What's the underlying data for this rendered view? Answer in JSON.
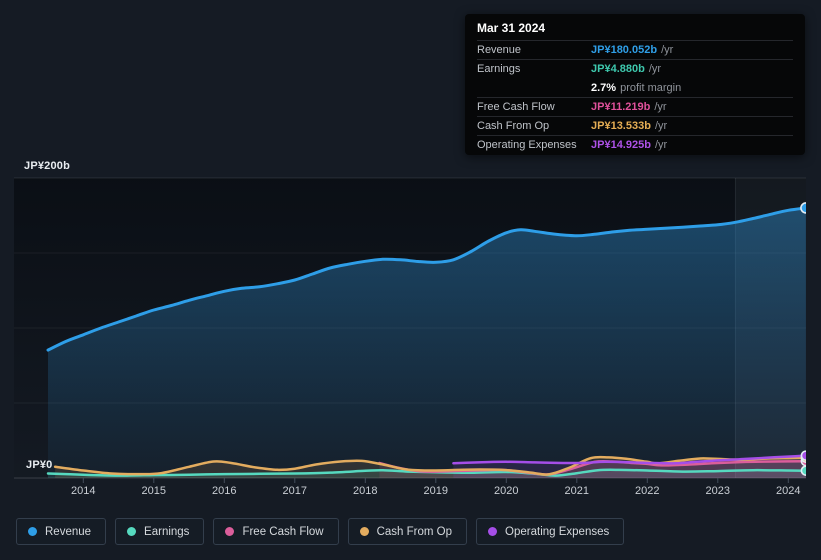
{
  "y_axis": {
    "top_label": "JP¥200b",
    "bottom_label": "JP¥0"
  },
  "x_axis": {
    "labels": [
      "2014",
      "2015",
      "2016",
      "2017",
      "2018",
      "2019",
      "2020",
      "2021",
      "2022",
      "2023",
      "2024"
    ]
  },
  "tooltip": {
    "title": "Mar 31 2024",
    "rows": [
      {
        "label": "Revenue",
        "value": "JP¥180.052b",
        "unit": "/yr",
        "color": "#2f9fe8"
      },
      {
        "label": "Earnings",
        "value": "JP¥4.880b",
        "unit": "/yr",
        "color": "#3ec9ae"
      },
      {
        "label": "Free Cash Flow",
        "value": "JP¥11.219b",
        "unit": "/yr",
        "color": "#e0519b"
      },
      {
        "label": "Cash From Op",
        "value": "JP¥13.533b",
        "unit": "/yr",
        "color": "#e6ae54"
      },
      {
        "label": "Operating Expenses",
        "value": "JP¥14.925b",
        "unit": "/yr",
        "color": "#ae52e8"
      }
    ],
    "profit_margin": {
      "value": "2.7%",
      "text": "profit margin"
    }
  },
  "legend": {
    "items": [
      {
        "label": "Revenue",
        "color": "#2e9ee8"
      },
      {
        "label": "Earnings",
        "color": "#56d9bf"
      },
      {
        "label": "Free Cash Flow",
        "color": "#db5e9b"
      },
      {
        "label": "Cash From Op",
        "color": "#e3ac5f"
      },
      {
        "label": "Operating Expenses",
        "color": "#a54ee8"
      }
    ]
  },
  "chart_data": {
    "type": "area",
    "title": "Company financial history, JP¥ billions vs fiscal year",
    "unit": "JP¥ billions per year",
    "ylim": [
      0,
      200
    ],
    "gridline_values": [
      0,
      50,
      100,
      150,
      200
    ],
    "x_tick_years": [
      2014,
      2015,
      2016,
      2017,
      2018,
      2019,
      2020,
      2021,
      2022,
      2023,
      2024
    ],
    "highlight_band_years": [
      2023.25,
      2024.32
    ],
    "legend_position": "bottom-left",
    "series": [
      {
        "name": "Revenue",
        "color": "#2e9ee8",
        "points": [
          [
            2013.5,
            85.3
          ],
          [
            2013.75,
            91
          ],
          [
            2014,
            95.5
          ],
          [
            2014.25,
            100
          ],
          [
            2014.5,
            104
          ],
          [
            2014.75,
            108
          ],
          [
            2015,
            112
          ],
          [
            2015.25,
            115
          ],
          [
            2015.5,
            118.5
          ],
          [
            2015.75,
            121.5
          ],
          [
            2016,
            124.5
          ],
          [
            2016.25,
            126.5
          ],
          [
            2016.5,
            127.5
          ],
          [
            2016.75,
            129.5
          ],
          [
            2017,
            132
          ],
          [
            2017.25,
            136
          ],
          [
            2017.5,
            140
          ],
          [
            2017.75,
            142.5
          ],
          [
            2018,
            144.5
          ],
          [
            2018.25,
            145.8
          ],
          [
            2018.5,
            145.5
          ],
          [
            2018.75,
            144.3
          ],
          [
            2019,
            143.8
          ],
          [
            2019.25,
            145.5
          ],
          [
            2019.5,
            151
          ],
          [
            2019.75,
            158
          ],
          [
            2020,
            163.5
          ],
          [
            2020.2,
            165.5
          ],
          [
            2020.4,
            164.5
          ],
          [
            2020.7,
            162.5
          ],
          [
            2021,
            161.5
          ],
          [
            2021.25,
            162.5
          ],
          [
            2021.5,
            164
          ],
          [
            2021.75,
            165.2
          ],
          [
            2022,
            165.8
          ],
          [
            2022.25,
            166.5
          ],
          [
            2022.5,
            167.2
          ],
          [
            2022.75,
            168
          ],
          [
            2023,
            168.8
          ],
          [
            2023.25,
            170.5
          ],
          [
            2023.5,
            173
          ],
          [
            2023.75,
            175.8
          ],
          [
            2024,
            178.5
          ],
          [
            2024.25,
            180.052
          ]
        ]
      },
      {
        "name": "Earnings",
        "color": "#56d9bf",
        "points": [
          [
            2013.5,
            3.0
          ],
          [
            2014,
            2.2
          ],
          [
            2014.5,
            1.6
          ],
          [
            2015,
            1.9
          ],
          [
            2015.5,
            2.2
          ],
          [
            2016,
            2.6
          ],
          [
            2016.5,
            2.8
          ],
          [
            2017,
            3.0
          ],
          [
            2017.5,
            3.6
          ],
          [
            2018,
            4.8
          ],
          [
            2018.25,
            5.2
          ],
          [
            2018.6,
            4.3
          ],
          [
            2019,
            3.8
          ],
          [
            2019.5,
            3.5
          ],
          [
            2020,
            4.0
          ],
          [
            2020.4,
            2.8
          ],
          [
            2020.7,
            1.6
          ],
          [
            2021,
            3.2
          ],
          [
            2021.3,
            5.2
          ],
          [
            2021.6,
            5.4
          ],
          [
            2022,
            5.0
          ],
          [
            2022.5,
            4.3
          ],
          [
            2023,
            4.6
          ],
          [
            2023.5,
            5.2
          ],
          [
            2024,
            5.0
          ],
          [
            2024.25,
            4.88
          ]
        ]
      },
      {
        "name": "Free Cash Flow",
        "color": "#db5e9b",
        "points": [
          [
            2018.2,
            10.0
          ],
          [
            2018.45,
            7.0
          ],
          [
            2018.75,
            4.6
          ],
          [
            2019,
            4.3
          ],
          [
            2019.35,
            4.7
          ],
          [
            2019.7,
            5.2
          ],
          [
            2020,
            5.3
          ],
          [
            2020.3,
            3.6
          ],
          [
            2020.6,
            2.4
          ],
          [
            2020.9,
            5.8
          ],
          [
            2021.25,
            10.7
          ],
          [
            2021.5,
            11.0
          ],
          [
            2021.8,
            10.0
          ],
          [
            2022,
            9.4
          ],
          [
            2022.2,
            8.4
          ],
          [
            2022.6,
            9.0
          ],
          [
            2023,
            10.0
          ],
          [
            2023.4,
            10.7
          ],
          [
            2023.8,
            11.0
          ],
          [
            2024.25,
            11.219
          ]
        ]
      },
      {
        "name": "Cash From Op",
        "color": "#e3ac5f",
        "points": [
          [
            2013.6,
            7.5
          ],
          [
            2014,
            5.0
          ],
          [
            2014.4,
            3.0
          ],
          [
            2014.8,
            2.6
          ],
          [
            2015.1,
            3.2
          ],
          [
            2015.5,
            7.5
          ],
          [
            2015.85,
            11.0
          ],
          [
            2016.1,
            10.0
          ],
          [
            2016.45,
            7.0
          ],
          [
            2016.75,
            5.5
          ],
          [
            2017,
            6.2
          ],
          [
            2017.3,
            9.0
          ],
          [
            2017.65,
            11.0
          ],
          [
            2017.95,
            11.4
          ],
          [
            2018.25,
            9.0
          ],
          [
            2018.6,
            5.6
          ],
          [
            2019,
            5.0
          ],
          [
            2019.5,
            5.6
          ],
          [
            2020,
            5.3
          ],
          [
            2020.35,
            3.6
          ],
          [
            2020.6,
            2.4
          ],
          [
            2020.9,
            7.0
          ],
          [
            2021.2,
            13.3
          ],
          [
            2021.45,
            13.7
          ],
          [
            2021.7,
            12.8
          ],
          [
            2022,
            10.8
          ],
          [
            2022.15,
            9.8
          ],
          [
            2022.45,
            11.5
          ],
          [
            2022.75,
            13.0
          ],
          [
            2023,
            12.7
          ],
          [
            2023.35,
            12.2
          ],
          [
            2023.7,
            13.0
          ],
          [
            2024,
            13.3
          ],
          [
            2024.25,
            13.533
          ]
        ]
      },
      {
        "name": "Operating Expenses",
        "color": "#a54ee8",
        "points": [
          [
            2019.25,
            9.8
          ],
          [
            2019.6,
            10.4
          ],
          [
            2020,
            10.8
          ],
          [
            2020.4,
            10.4
          ],
          [
            2020.8,
            10.0
          ],
          [
            2021.1,
            10.1
          ],
          [
            2021.4,
            10.8
          ],
          [
            2021.8,
            10.4
          ],
          [
            2022.1,
            10.0
          ],
          [
            2022.4,
            9.8
          ],
          [
            2022.7,
            10.8
          ],
          [
            2023,
            11.7
          ],
          [
            2023.4,
            12.7
          ],
          [
            2023.8,
            13.8
          ],
          [
            2024.1,
            14.5
          ],
          [
            2024.25,
            14.925
          ]
        ]
      }
    ]
  }
}
